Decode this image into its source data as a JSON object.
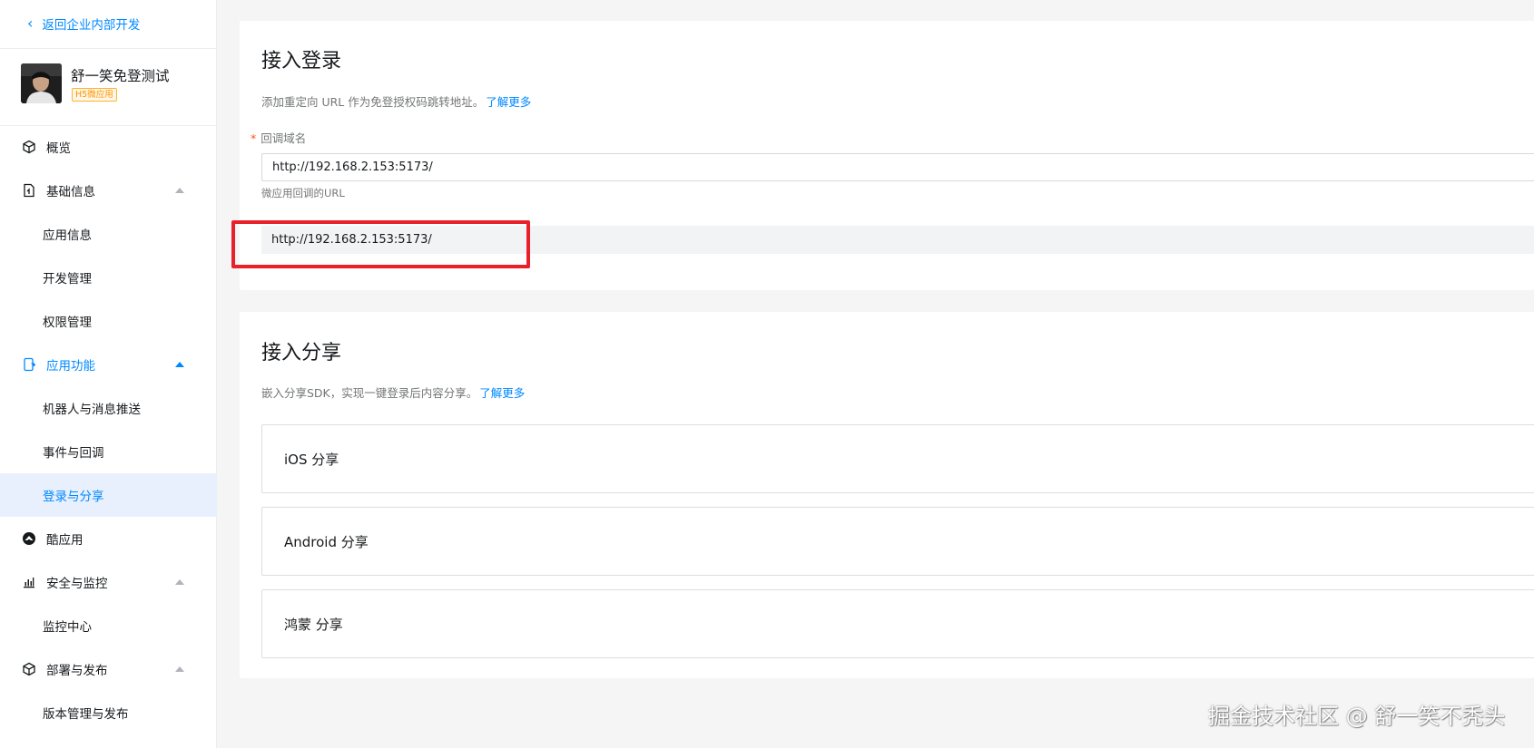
{
  "sidebar": {
    "back_label": "返回企业内部开发",
    "app": {
      "name": "舒一笑免登测试",
      "tag": "H5微应用"
    },
    "items": [
      {
        "label": "概览",
        "icon": "cube-icon",
        "type": "top"
      },
      {
        "label": "基础信息",
        "icon": "document-icon",
        "type": "top",
        "expanded": true
      },
      {
        "label": "应用信息",
        "type": "sub"
      },
      {
        "label": "开发管理",
        "type": "sub"
      },
      {
        "label": "权限管理",
        "type": "sub"
      },
      {
        "label": "应用功能",
        "icon": "phone-feature-icon",
        "type": "top",
        "expanded": true,
        "active": true
      },
      {
        "label": "机器人与消息推送",
        "type": "sub"
      },
      {
        "label": "事件与回调",
        "type": "sub"
      },
      {
        "label": "登录与分享",
        "type": "sub",
        "selected": true
      },
      {
        "label": "酷应用",
        "icon": "cool-app-icon",
        "type": "top"
      },
      {
        "label": "安全与监控",
        "icon": "bar-chart-icon",
        "type": "top",
        "expanded": true
      },
      {
        "label": "监控中心",
        "type": "sub"
      },
      {
        "label": "部署与发布",
        "icon": "cube-icon",
        "type": "top",
        "expanded": true
      },
      {
        "label": "版本管理与发布",
        "type": "sub"
      }
    ]
  },
  "login_section": {
    "title": "接入登录",
    "description": "添加重定向 URL 作为免登授权码跳转地址。",
    "learn_more": "了解更多",
    "field_required_mark": "*",
    "field_label": "回调域名",
    "field_value": "http://192.168.2.153:5173/",
    "field_hint": "微应用回调的URL",
    "saved_url": "http://192.168.2.153:5173/"
  },
  "share_section": {
    "title": "接入分享",
    "description": "嵌入分享SDK，实现一键登录后内容分享。",
    "learn_more": "了解更多",
    "items": [
      "iOS 分享",
      "Android 分享",
      "鸿蒙 分享"
    ]
  },
  "watermark": "掘金技术社区 @ 舒一笑不秃头",
  "colors": {
    "accent": "#0089ff",
    "highlight": "#e8202a",
    "tag": "#ff9200"
  }
}
